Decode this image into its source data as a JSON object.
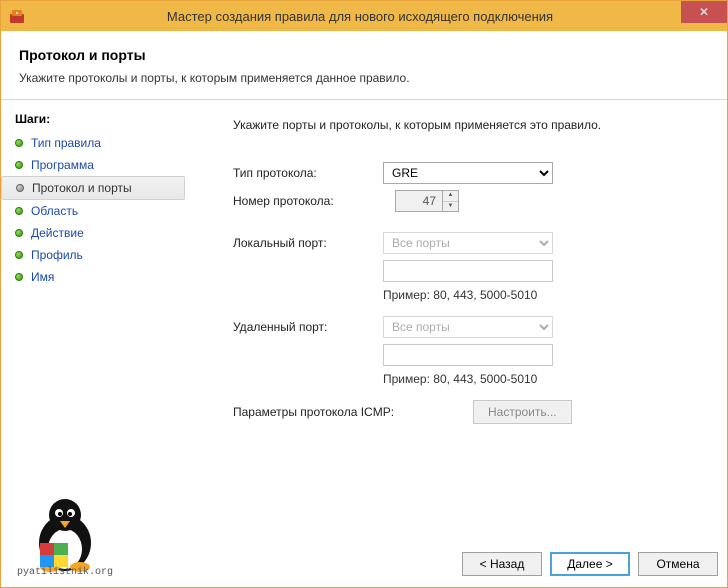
{
  "window": {
    "title": "Мастер создания правила для нового исходящего подключения"
  },
  "header": {
    "title": "Протокол и порты",
    "subtitle": "Укажите протоколы и порты, к которым применяется данное правило."
  },
  "sidebar": {
    "heading": "Шаги:",
    "steps": [
      {
        "label": "Тип правила"
      },
      {
        "label": "Программа"
      },
      {
        "label": "Протокол и порты"
      },
      {
        "label": "Область"
      },
      {
        "label": "Действие"
      },
      {
        "label": "Профиль"
      },
      {
        "label": "Имя"
      }
    ]
  },
  "content": {
    "intro": "Укажите порты и протоколы, к которым применяется это правило.",
    "protocol_type_label": "Тип протокола:",
    "protocol_type_value": "GRE",
    "protocol_number_label": "Номер протокола:",
    "protocol_number_value": "47",
    "local_port_label": "Локальный порт:",
    "local_port_value": "Все порты",
    "local_port_example": "Пример: 80, 443, 5000-5010",
    "remote_port_label": "Удаленный порт:",
    "remote_port_value": "Все порты",
    "remote_port_example": "Пример: 80, 443, 5000-5010",
    "icmp_label": "Параметры протокола ICMP:",
    "icmp_button": "Настроить..."
  },
  "footer": {
    "back": "< Назад",
    "next": "Далее >",
    "cancel": "Отмена"
  },
  "watermark": {
    "text": "pyatilistnik.org"
  }
}
